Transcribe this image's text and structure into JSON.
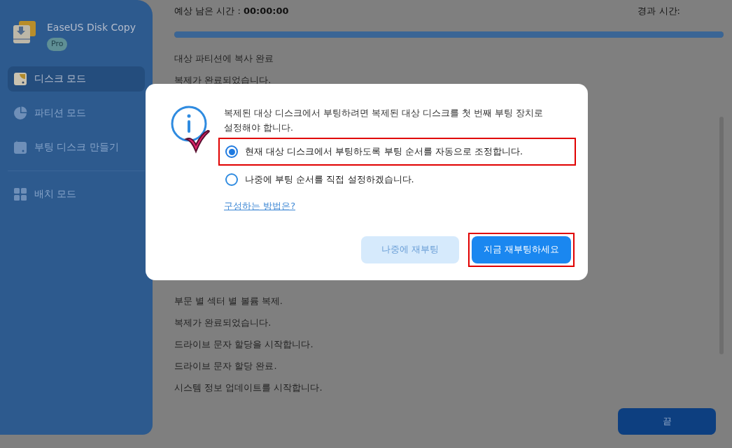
{
  "app": {
    "name": "EaseUS Disk Copy",
    "badge": "Pro"
  },
  "sidebar": {
    "items": [
      {
        "label": "디스크 모드",
        "kind": "disk",
        "selected": true,
        "disabled": false
      },
      {
        "label": "파티션 모드",
        "kind": "pie",
        "selected": false,
        "disabled": true
      },
      {
        "label": "부팅 디스크 만들기",
        "kind": "boot",
        "selected": false,
        "disabled": true
      },
      {
        "label": "배치 모드",
        "kind": "grid",
        "selected": false,
        "disabled": true
      }
    ]
  },
  "progress": {
    "remaining_label": "예상 남은 시간 : ",
    "remaining_value": "00:00:00",
    "elapsed_label": "경과 시간:",
    "level": 1
  },
  "log": {
    "lines_above": [
      "대상 파티션에 복사 완료",
      "복제가 완료되었습니다."
    ],
    "lines_below": [
      "부문 별 섹터 별 볼륨 복제.",
      "복제가 완료되었습니다.",
      "드라이브 문자 할당을 시작합니다.",
      "드라이브 문자 할당 완료.",
      "시스템 정보 업데이트를 시작합니다."
    ]
  },
  "finish_button": "끝",
  "dialog": {
    "message": "복제된 대상 디스크에서 부팅하려면 복제된 대상 디스크를 첫 번째 부팅 장치로 설정해야 합니다.",
    "options": [
      {
        "label": "현재 대상 디스크에서 부팅하도록 부팅 순서를 자동으로 조정합니다.",
        "selected": true,
        "highlighted": true
      },
      {
        "label": "나중에 부팅 순서를 직접 설정하겠습니다.",
        "selected": false,
        "highlighted": false
      }
    ],
    "link": "구성하는 방법은?",
    "buttons": [
      {
        "label": "나중에 재부팅",
        "kind": "secondary",
        "highlighted": false
      },
      {
        "label": "지금 재부팅하세요",
        "kind": "primary",
        "highlighted": true
      }
    ]
  }
}
